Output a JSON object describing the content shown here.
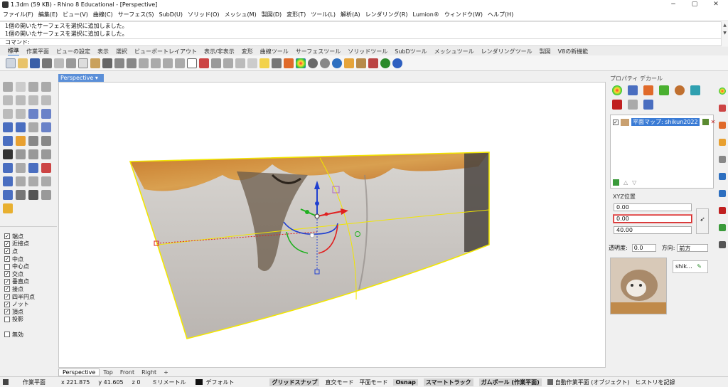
{
  "window": {
    "title": "1.3dm (59 KB) - Rhino 8 Educational - [Perspective]",
    "minimize": "−",
    "maximize": "▢",
    "close": "✕"
  },
  "menu": [
    "ファイル(F)",
    "編集(E)",
    "ビュー(V)",
    "曲線(C)",
    "サーフェス(S)",
    "SubD(U)",
    "ソリッド(O)",
    "メッシュ(M)",
    "製図(D)",
    "変形(T)",
    "ツール(L)",
    "解析(A)",
    "レンダリング(R)",
    "Lumion®",
    "ウィンドウ(W)",
    "ヘルプ(H)"
  ],
  "history": [
    "1個の開いたサーフェスを選択に追加しました。",
    "1個の開いたサーフェスを選択に追加しました。"
  ],
  "command_label": "コマンド:",
  "toolbar_tabs": [
    "標準",
    "作業平面",
    "ビューの設定",
    "表示",
    "選択",
    "ビューポートレイアウト",
    "表示/非表示",
    "変形",
    "曲線ツール",
    "サーフェスツール",
    "ソリッドツール",
    "SubDツール",
    "メッシュツール",
    "レンダリングツール",
    "製図",
    "V8の新機能"
  ],
  "viewport": {
    "title": "Perspective",
    "tabs": [
      "Perspective",
      "Top",
      "Front",
      "Right",
      "+"
    ]
  },
  "osnaps": [
    {
      "label": "端点",
      "checked": true
    },
    {
      "label": "近接点",
      "checked": true
    },
    {
      "label": "点",
      "checked": true
    },
    {
      "label": "中点",
      "checked": true
    },
    {
      "label": "中心点",
      "checked": false
    },
    {
      "label": "交点",
      "checked": true
    },
    {
      "label": "垂直点",
      "checked": true
    },
    {
      "label": "接点",
      "checked": true
    },
    {
      "label": "四半円点",
      "checked": true
    },
    {
      "label": "ノット",
      "checked": true
    },
    {
      "label": "頂点",
      "checked": true
    },
    {
      "label": "投影",
      "checked": false
    },
    {
      "label": "",
      "checked": false
    },
    {
      "label": "無効",
      "checked": false
    }
  ],
  "right_panel": {
    "header": "プロパティ デカール",
    "texture_label": "平面マップ: shikun2022",
    "xyz_label": "XYZ位置",
    "xyz": [
      "0.00",
      "0.00",
      "40.00"
    ],
    "opacity_label": "透明度:",
    "opacity_value": "0.0",
    "direction_label": "方向:",
    "direction_value": "前方",
    "preview_name": "shik..."
  },
  "status": {
    "plane": "作業平面",
    "x": "x 221.875",
    "y": "y 41.605",
    "z": "z 0",
    "unit": "ミリメートル",
    "layer": "デフォルト",
    "grid_snap": "グリッドスナップ",
    "ortho": "直交モード",
    "planar": "平面モード",
    "osnap": "Osnap",
    "smart_track": "スマートトラック",
    "gumball": "ガムボール (作業平面)",
    "auto_cplane": "自動作業平面 (オブジェクト)",
    "history": "ヒストリを記録"
  },
  "colors": {
    "accent": "#3a7bd5",
    "surface_edge": "#f2e600",
    "gumball_x": "#e02020",
    "gumball_y": "#20b020",
    "gumball_z": "#2040d0"
  }
}
